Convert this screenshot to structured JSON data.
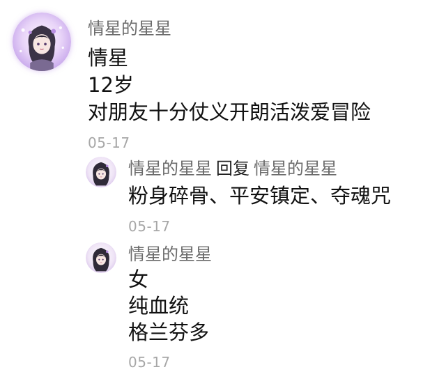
{
  "comments": [
    {
      "author": "情星的星星",
      "lines": [
        "情星",
        "12岁",
        "对朋友十分仗义开朗活泼爱冒险"
      ],
      "date": "05-17",
      "avatar_icon": "anime-girl-avatar-icon"
    }
  ],
  "replies": [
    {
      "author": "情星的星星",
      "reply_keyword": "回复",
      "reply_to": "情星的星星",
      "lines": [
        "粉身碎骨、平安镇定、夺魂咒"
      ],
      "date": "05-17",
      "avatar_icon": "anime-girl-avatar-icon"
    },
    {
      "author": "情星的星星",
      "lines": [
        "女",
        "纯血统",
        "格兰芬多"
      ],
      "date": "05-17",
      "avatar_icon": "anime-girl-avatar-icon"
    }
  ],
  "colors": {
    "author": "#6b6b6b",
    "text": "#111111",
    "date": "#a7a7a7",
    "avatar_glow": "#c9a7ee"
  }
}
